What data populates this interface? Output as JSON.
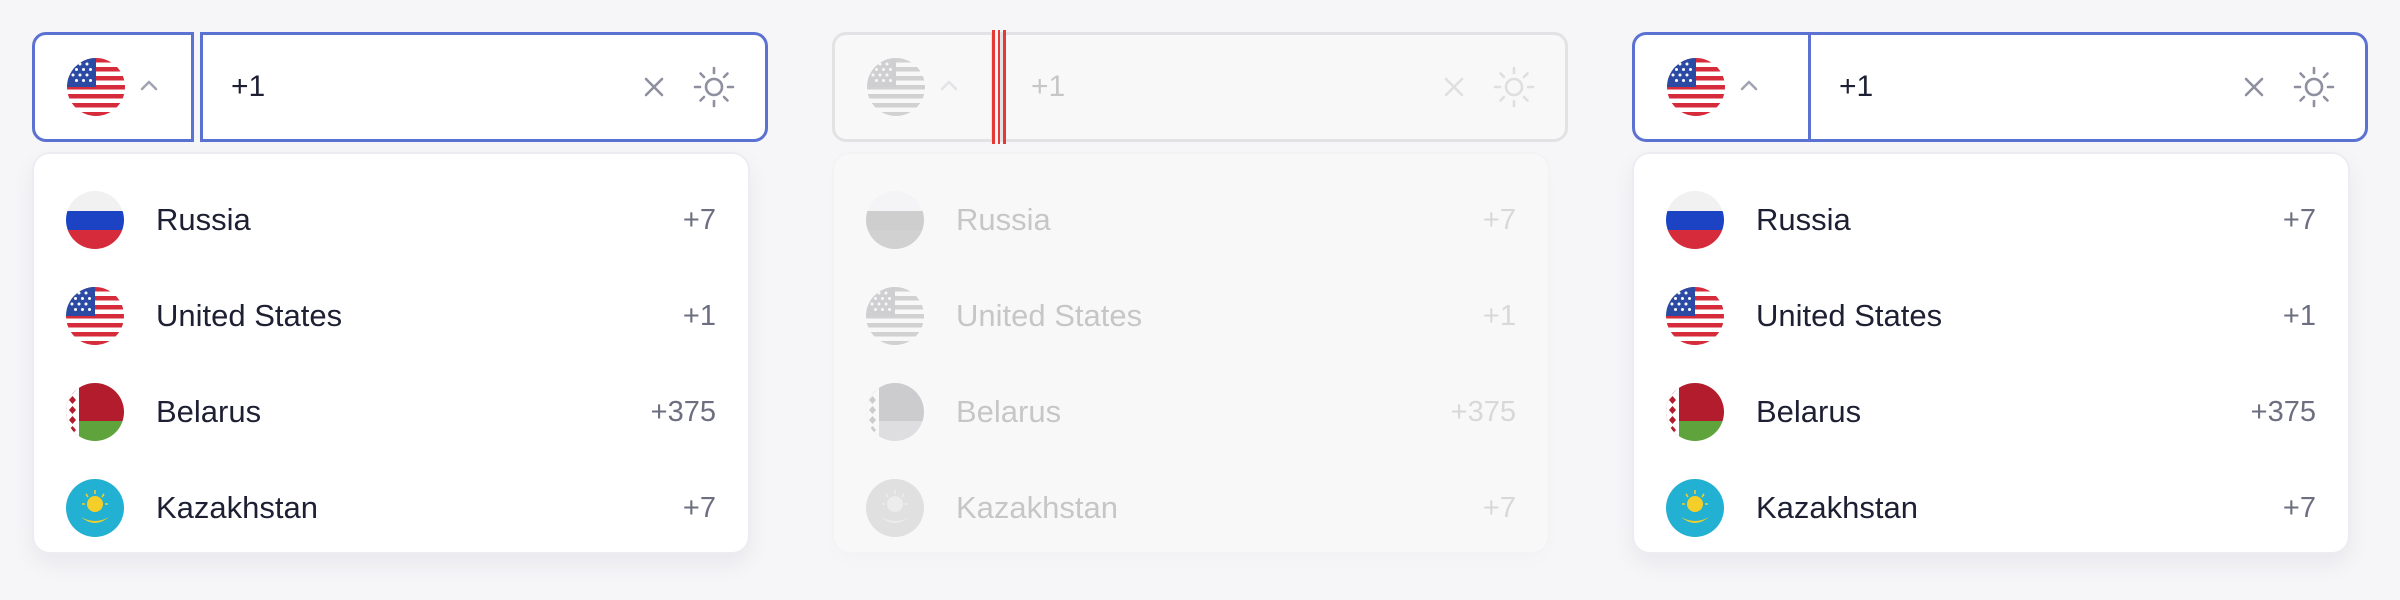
{
  "colors": {
    "accent": "#5b72d2",
    "marker": "#e53935",
    "text": "#1d1f33",
    "muted": "#6d6f80"
  },
  "field": {
    "value": "+1",
    "selected_flag": "united-states",
    "clear_icon": "close-icon",
    "theme_icon": "sun-icon",
    "toggle_icon": "chevron-up-icon"
  },
  "countries": [
    {
      "name": "Russia",
      "code": "+7",
      "flag": "russia"
    },
    {
      "name": "United States",
      "code": "+1",
      "flag": "united-states"
    },
    {
      "name": "Belarus",
      "code": "+375",
      "flag": "belarus"
    },
    {
      "name": "Kazakhstan",
      "code": "+7",
      "flag": "kazakhstan"
    }
  ]
}
